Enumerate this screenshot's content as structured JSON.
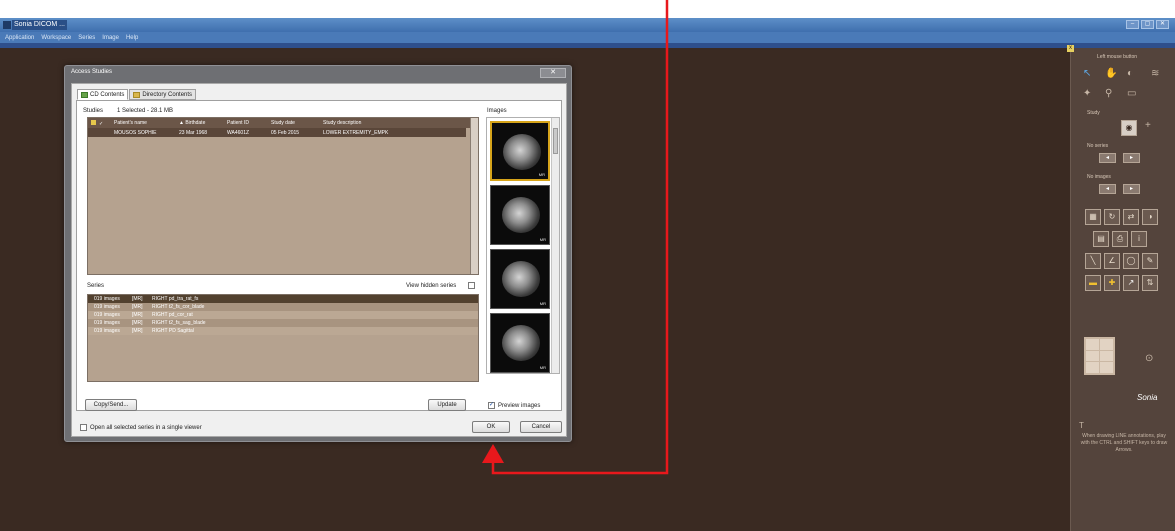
{
  "window": {
    "title": "Sonia DICOM ...",
    "menu": [
      "Application",
      "Workspace",
      "Series",
      "Image",
      "Help"
    ],
    "controls": [
      "–",
      "▢",
      "✕"
    ]
  },
  "dialog": {
    "title": "Access Studies",
    "close": "✕",
    "tabs": [
      "CD Contents",
      "Directory Contents"
    ],
    "studies_label": "Studies",
    "studies_summary": "1 Selected - 28.1 MB",
    "images_label": "Images",
    "study_columns": [
      "Patient's name",
      "▲ Birthdate",
      "Patient ID",
      "Study date",
      "Study description"
    ],
    "study_rows": [
      {
        "name": "MOUSOS SOPHIE",
        "birthdate": "23 Mar 1968",
        "patient_id": "WA4601Z",
        "study_date": "05 Feb 2015",
        "description": "LOWER EXTREMITY_EMPK"
      }
    ],
    "series_label": "Series",
    "view_hidden_label": "View hidden series",
    "series": [
      {
        "count": "019 images",
        "modality": "[MR]",
        "name": "RIGHT pd_tra_rat_fs"
      },
      {
        "count": "019 images",
        "modality": "[MR]",
        "name": "RIGHT t2_fs_cor_blade"
      },
      {
        "count": "019 images",
        "modality": "[MR]",
        "name": "RIGHT pd_cor_rat"
      },
      {
        "count": "019 images",
        "modality": "[MR]",
        "name": "RIGHT t2_fs_sag_blade"
      },
      {
        "count": "019 images",
        "modality": "[MR]",
        "name": "RIGHT PD Sagittal"
      }
    ],
    "thumb_tag": "MR",
    "copy_send": "Copy/Send...",
    "update": "Update",
    "preview_images": "Preview images",
    "open_all": "Open all selected series in a single viewer",
    "ok": "OK",
    "cancel": "Cancel"
  },
  "right_panel": {
    "left_mouse": "Left mouse button",
    "study": "Study",
    "no_series": "No series",
    "no_images": "No images",
    "logo": "Sonia",
    "tip": "When drawing LINE annotations, play with the CTRL and SHIFT keys to draw Arrows."
  },
  "colors": {
    "annotation_arrow": "#e8181c",
    "workspace_bg": "#3a2a22",
    "list_bg": "#b5a28f"
  }
}
